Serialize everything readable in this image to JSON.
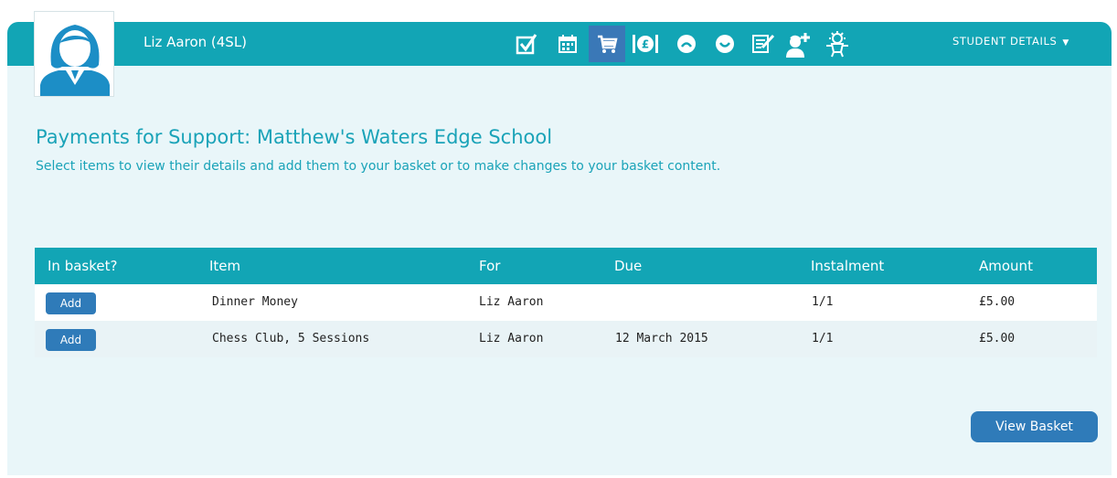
{
  "student": {
    "name": "Liz Aaron (4SL)"
  },
  "nav": {
    "icons": [
      "checkbox-icon",
      "calendar-icon",
      "basket-icon",
      "money-icon",
      "sad-face-icon",
      "happy-face-icon",
      "report-icon",
      "person-add-icon",
      "badge-icon"
    ],
    "active": "basket-icon",
    "student_details_label": "STUDENT DETAILS",
    "caret": "▼"
  },
  "page": {
    "title": "Payments for Support: Matthew's Waters Edge School",
    "subtitle": "Select items to view their details and add them to your basket or to make changes to your basket content."
  },
  "table": {
    "headers": [
      "In basket?",
      "Item",
      "For",
      "Due",
      "Instalment",
      "Amount"
    ],
    "rows": [
      {
        "action": "Add",
        "item": "Dinner Money",
        "for": "Liz Aaron",
        "due": "",
        "instalment": "1/1",
        "amount": "£5.00"
      },
      {
        "action": "Add",
        "item": "Chess Club, 5 Sessions",
        "for": "Liz Aaron",
        "due": "12 March 2015",
        "instalment": "1/1",
        "amount": "£5.00"
      }
    ]
  },
  "buttons": {
    "view_basket": "View Basket"
  },
  "colors": {
    "teal": "#12a5b5",
    "blue": "#2f7bb9",
    "panel": "#e9f6f9",
    "title": "#1aa3b8"
  }
}
